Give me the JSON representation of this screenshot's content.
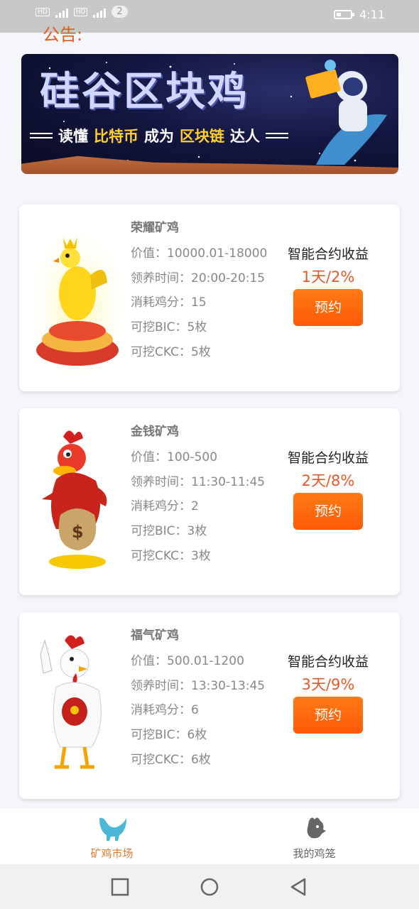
{
  "status_bar": {
    "badge_count": "2",
    "time": "4:11",
    "signal_labels": [
      "4G",
      "4G"
    ]
  },
  "notice": {
    "text": "公告:"
  },
  "banner": {
    "title": "硅谷区块鸡",
    "subtitle_parts": [
      "读懂",
      "比特币",
      "成为",
      "区块链",
      "达人"
    ]
  },
  "cards": [
    {
      "name": "荣耀矿鸡",
      "value": "价值：10000.01-18000",
      "time": "领养时间：20:00-20:15",
      "cost": "消耗鸡分：15",
      "bic": "可挖BIC：5枚",
      "ckc": "可挖CKC：5枚",
      "contract_label": "智能合约收益",
      "rate": "1天/2%",
      "button": "预约",
      "icon": "crowned-chicken-on-coins"
    },
    {
      "name": "金钱矿鸡",
      "value": "价值：100-500",
      "time": "领养时间：11:30-11:45",
      "cost": "消耗鸡分：2",
      "bic": "可挖BIC：3枚",
      "ckc": "可挖CKC：3枚",
      "contract_label": "智能合约收益",
      "rate": "2天/8%",
      "button": "预约",
      "icon": "rooster-with-money-bag"
    },
    {
      "name": "福气矿鸡",
      "value": "价值：500.01-1200",
      "time": "领养时间：13:30-13:45",
      "cost": "消耗鸡分：6",
      "bic": "可挖BIC：6枚",
      "ckc": "可挖CKC：6枚",
      "contract_label": "智能合约收益",
      "rate": "3天/9%",
      "button": "预约",
      "icon": "white-rooster-blessing"
    }
  ],
  "tabbar": {
    "tabs": [
      {
        "label": "矿鸡市场",
        "icon": "chicken-icon",
        "active": true
      },
      {
        "label": "我的鸡笼",
        "icon": "rooster-head-icon",
        "active": false
      }
    ]
  },
  "colors": {
    "accent": "#ff6a0a",
    "rate_text": "#e4592a",
    "active_tab": "#e07a2e",
    "tab_icon_active": "#4bb8d6"
  }
}
